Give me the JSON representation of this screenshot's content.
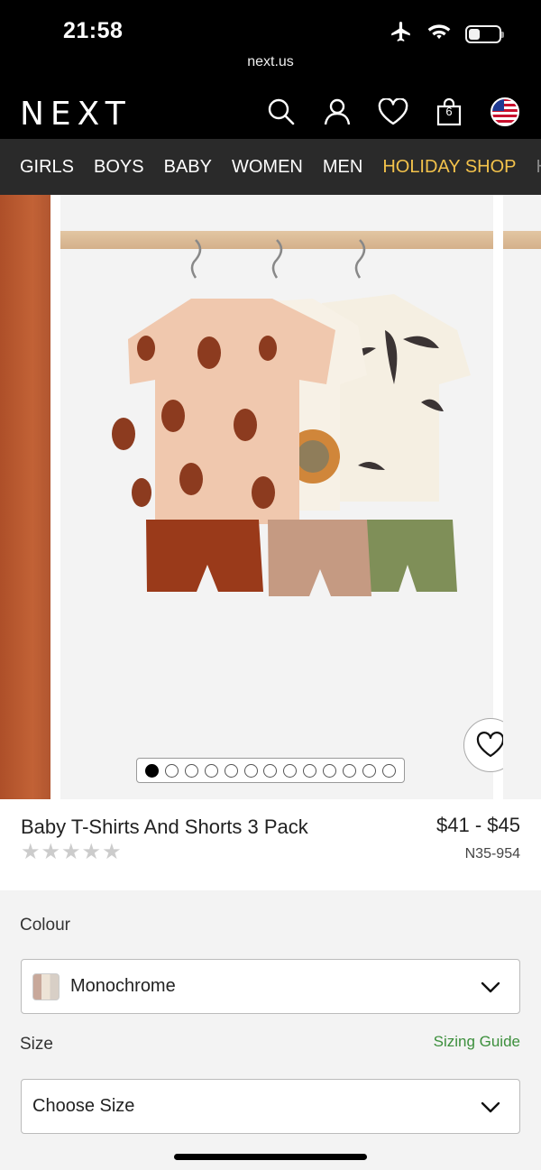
{
  "status_bar": {
    "time": "21:58",
    "url": "next.us",
    "battery_level": 0.25
  },
  "header": {
    "logo": "NEXT",
    "icons": [
      "search-icon",
      "account-icon",
      "wishlist-icon",
      "bag-icon",
      "us-flag-icon"
    ],
    "bag_count": "6"
  },
  "nav": {
    "items": [
      "GIRLS",
      "BOYS",
      "BABY",
      "WOMEN",
      "MEN",
      "HOLIDAY SHOP",
      "H"
    ],
    "highlight_color": "#f3c24b"
  },
  "gallery": {
    "total_images": 13,
    "active_index": 0
  },
  "product": {
    "name": "Baby T-Shirts And Shorts 3 Pack",
    "price": "$41 - $45",
    "sku": "N35-954",
    "rating_stars": 0
  },
  "options": {
    "colour_label": "Colour",
    "colour_value": "Monochrome",
    "size_label": "Size",
    "sizing_guide": "Sizing Guide",
    "size_placeholder": "Choose Size"
  },
  "colors": {
    "brand_black": "#000000",
    "accent_green": "#3c8f3c",
    "nav_bg": "#2a2a2a"
  }
}
